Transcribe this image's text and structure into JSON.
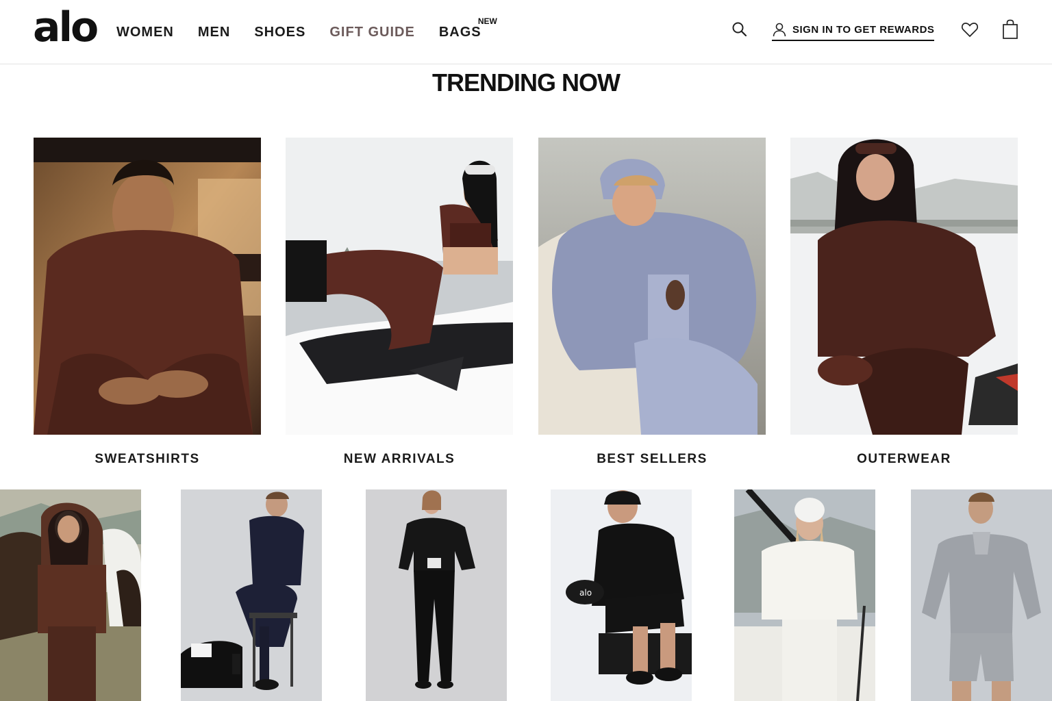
{
  "brand": {
    "logo_text": "alo"
  },
  "nav": {
    "items": [
      {
        "label": "WOMEN"
      },
      {
        "label": "MEN"
      },
      {
        "label": "SHOES"
      },
      {
        "label": "GIFT GUIDE"
      },
      {
        "label": "BAGS",
        "badge": "NEW"
      }
    ]
  },
  "header_actions": {
    "search_icon": "search-icon",
    "account_icon": "user-icon",
    "signin_label": "SIGN IN TO GET REWARDS",
    "wishlist_icon": "heart-icon",
    "bag_icon": "shopping-bag-icon"
  },
  "trending": {
    "title": "TRENDING NOW",
    "categories": [
      {
        "label": "SWEATSHIRTS"
      },
      {
        "label": "NEW ARRIVALS"
      },
      {
        "label": "BEST SELLERS"
      },
      {
        "label": "OUTERWEAR"
      }
    ]
  },
  "colors": {
    "text": "#111111",
    "gift_guide": "#6b5a5a",
    "divider": "#e3e3e3"
  }
}
